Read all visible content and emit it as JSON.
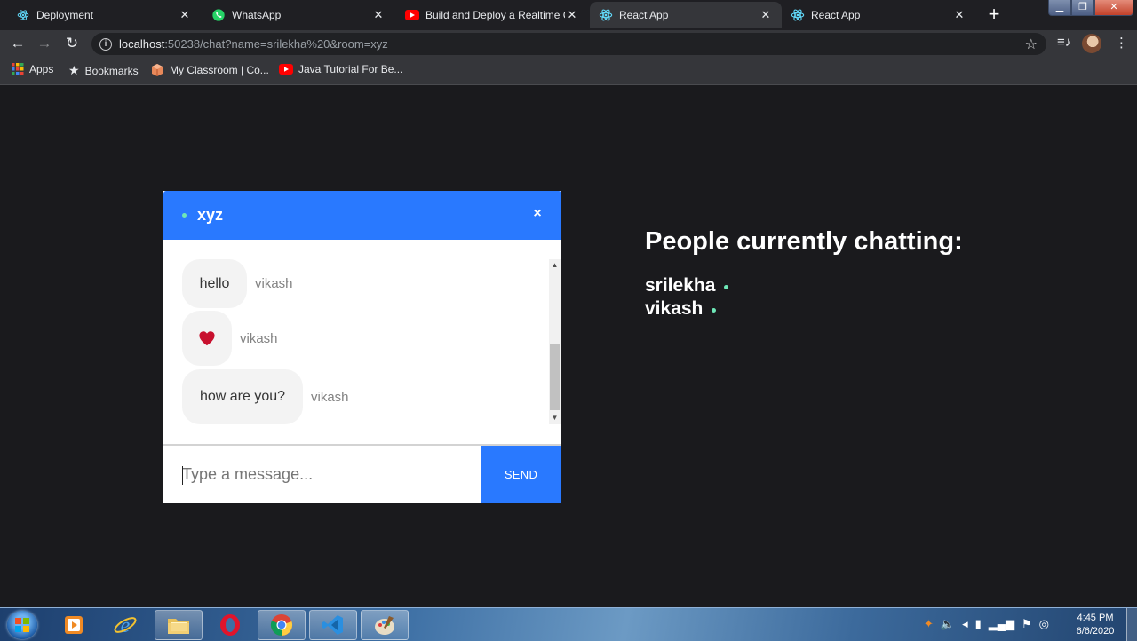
{
  "browser": {
    "tabs": [
      {
        "title": "Deployment",
        "icon": "react-icon",
        "active": false
      },
      {
        "title": "WhatsApp",
        "icon": "whatsapp-icon",
        "active": false
      },
      {
        "title": "Build and Deploy a Realtime Ch",
        "icon": "youtube-icon",
        "active": false
      },
      {
        "title": "React App",
        "icon": "react-icon",
        "active": true
      },
      {
        "title": "React App",
        "icon": "react-icon",
        "active": false
      }
    ],
    "new_tab_label": "+",
    "url": {
      "host": "localhost",
      "rest": ":50238/chat?name=srilekha%20&room=xyz"
    },
    "bookmarks": [
      {
        "label": "Apps",
        "icon": "apps-grid-icon"
      },
      {
        "label": "Bookmarks",
        "icon": "star-icon"
      },
      {
        "label": "My Classroom | Co...",
        "icon": "classroom-icon"
      },
      {
        "label": "Java Tutorial For Be...",
        "icon": "youtube-icon"
      }
    ]
  },
  "chat": {
    "room": "xyz",
    "close_label": "×",
    "messages": [
      {
        "text": "hello",
        "sender": "vikash"
      },
      {
        "text": "",
        "emoji": "heart-icon",
        "sender": "vikash"
      },
      {
        "text": "how are you?",
        "sender": "vikash"
      }
    ],
    "input_placeholder": "Type a message...",
    "send_label": "send"
  },
  "people": {
    "title": "People currently chatting:",
    "users": [
      "srilekha",
      "vikash"
    ]
  },
  "taskbar": {
    "apps": [
      "windows-media-icon",
      "internet-explorer-icon",
      "file-explorer-icon",
      "opera-icon",
      "chrome-icon",
      "vscode-icon",
      "paint-icon"
    ],
    "clock": {
      "time": "4:45 PM",
      "date": "6/6/2020"
    }
  },
  "colors": {
    "accent": "#2979ff",
    "online": "#6ee7b7",
    "page_bg": "#1a1a1d"
  }
}
